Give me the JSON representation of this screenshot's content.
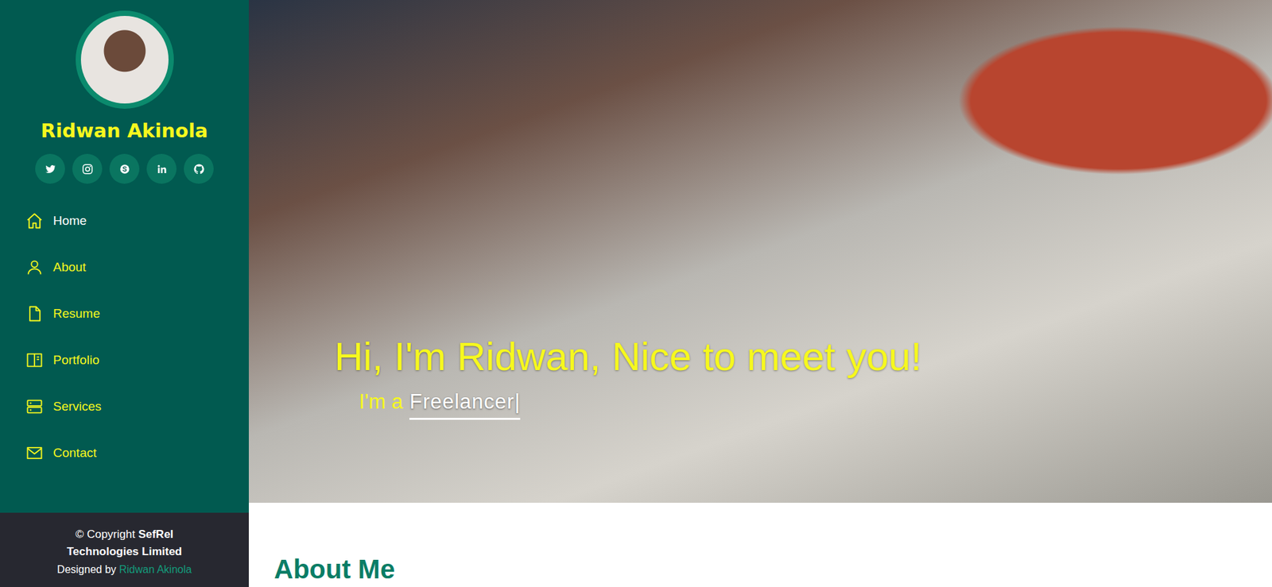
{
  "profile": {
    "name": "Ridwan Akinola"
  },
  "nav": [
    {
      "label": "Home",
      "icon": "home",
      "selected": true
    },
    {
      "label": "About",
      "icon": "user",
      "selected": false
    },
    {
      "label": "Resume",
      "icon": "file",
      "selected": false
    },
    {
      "label": "Portfolio",
      "icon": "book",
      "selected": false
    },
    {
      "label": "Services",
      "icon": "server",
      "selected": false
    },
    {
      "label": "Contact",
      "icon": "mail",
      "selected": false
    }
  ],
  "footer": {
    "copyright": "© Copyright",
    "company": "SefRel Technologies Limited",
    "designed_by": "Designed by",
    "designer": "Ridwan Akinola"
  },
  "hero": {
    "title": "Hi, I'm Ridwan, Nice to meet you!",
    "prefix": "I'm a",
    "typed": "Freelancer",
    "cursor": "|"
  },
  "about": {
    "heading": "About Me"
  }
}
